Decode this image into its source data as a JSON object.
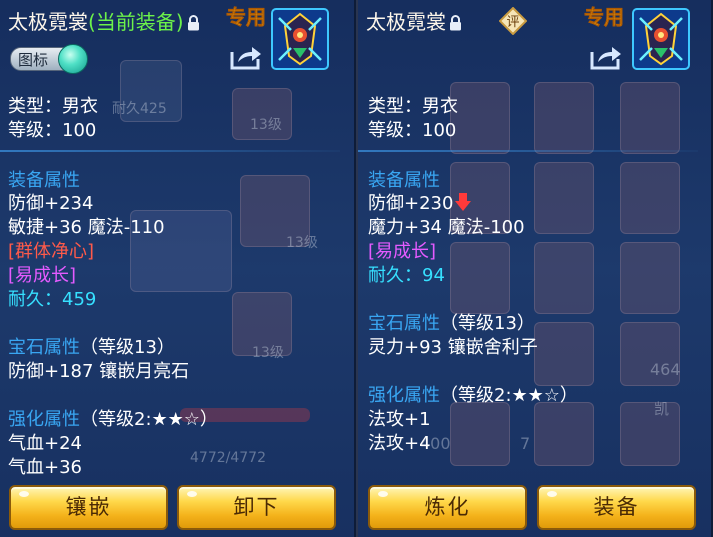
{
  "left": {
    "title": "太极霓裳",
    "current_tag": "(当前装备)",
    "exclusive": "专用",
    "icon_toggle": "图标",
    "type": "类型：男衣",
    "level": "等级：100",
    "attr_heading": "装备属性",
    "attrs": [
      "防御+234",
      "敏捷+36 魔法-110"
    ],
    "special": "[群体净心]",
    "growth": "[易成长]",
    "durability_label": "耐久：",
    "durability_value": "459",
    "gem_heading": "宝石属性",
    "gem_level": "（等级13）",
    "gem_attr": "防御+187 镶嵌月亮石",
    "enh_heading": "强化属性",
    "enh_level": "（等级2:★★☆）",
    "enh_attrs": [
      "气血+24",
      "气血+36"
    ],
    "buttons": [
      "镶嵌",
      "卸下"
    ]
  },
  "right": {
    "title": "太极霓裳",
    "eval_badge": "评",
    "exclusive": "专用",
    "type": "类型：男衣",
    "level": "等级：100",
    "attr_heading": "装备属性",
    "attrs": [
      "防御+230",
      "魔力+34 魔法-100"
    ],
    "growth": "[易成长]",
    "durability_label": "耐久：",
    "durability_value": "94",
    "gem_heading": "宝石属性",
    "gem_level": "（等级13）",
    "gem_attr": "灵力+93 镶嵌舍利子",
    "enh_heading": "强化属性",
    "enh_level": "（等级2:★★☆）",
    "enh_attrs": [
      "法攻+1",
      "法攻+4"
    ],
    "buttons": [
      "炼化",
      "装备"
    ]
  },
  "background": {
    "durability_text": "耐久425",
    "grade_labels": [
      "13级",
      "13级",
      "13级"
    ],
    "hp_text": "4772/4772",
    "numbers": [
      "464",
      "400",
      "7"
    ],
    "side_text": "凯"
  },
  "colors": {
    "panel": "#1c3a6e",
    "heading": "#39a6f2",
    "value": "#36e0ff",
    "special": "#ff5a4a",
    "growth": "#e45bff",
    "button": "#ffd84a",
    "current": "#6cf24a",
    "exclusive": "#ffe23c"
  },
  "icons": [
    "lock-icon",
    "share-icon",
    "equipment-icon",
    "eval-badge-icon",
    "down-arrow-icon"
  ]
}
